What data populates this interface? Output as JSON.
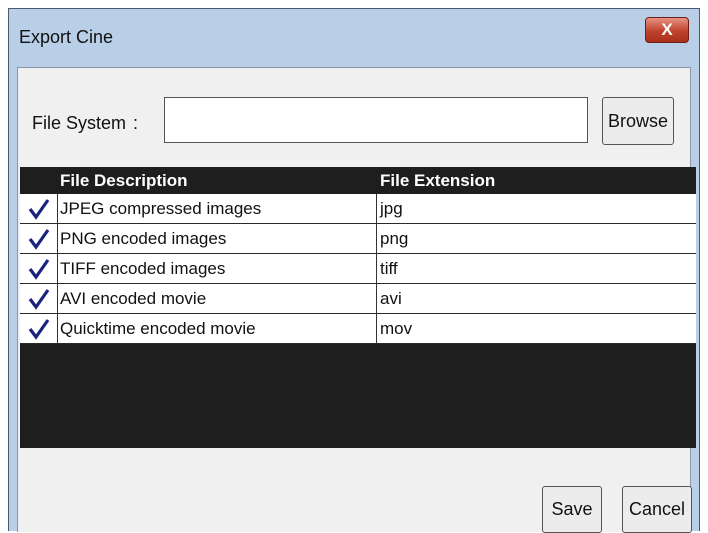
{
  "window": {
    "title": "Export Cine",
    "close_label": "X"
  },
  "file_system": {
    "label": "File System",
    "colon": ":",
    "value": "",
    "browse_label": "Browse"
  },
  "table": {
    "columns": [
      "File Description",
      "File Extension"
    ],
    "rows": [
      {
        "checked": true,
        "description": "JPEG compressed images",
        "extension": "jpg"
      },
      {
        "checked": true,
        "description": "PNG encoded images",
        "extension": "png"
      },
      {
        "checked": true,
        "description": "TIFF encoded images",
        "extension": "tiff"
      },
      {
        "checked": true,
        "description": "AVI encoded movie",
        "extension": "avi"
      },
      {
        "checked": true,
        "description": "Quicktime encoded movie",
        "extension": "mov"
      }
    ]
  },
  "buttons": {
    "save_label": "Save",
    "cancel_label": "Cancel"
  },
  "colors": {
    "checkmark": "#1a237e",
    "table_background": "#1e1e1e",
    "close_button": "#c0432c"
  }
}
